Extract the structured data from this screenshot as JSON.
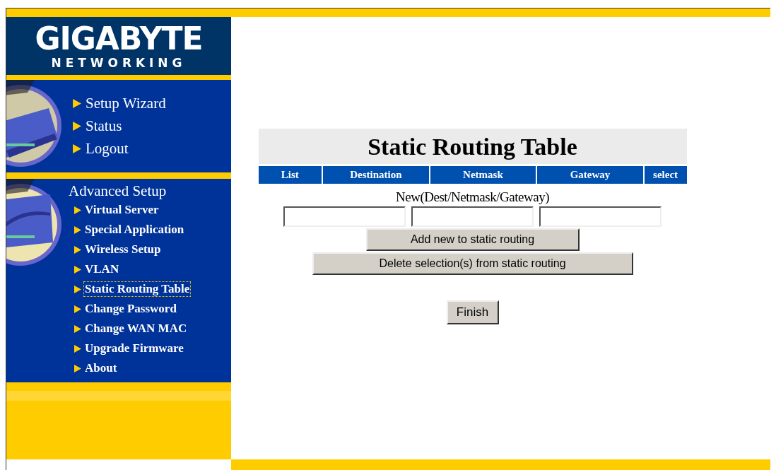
{
  "logo": {
    "brand": "GIGABYTE",
    "subtitle": "NETWORKING"
  },
  "top_menu": [
    {
      "label": "Setup Wizard"
    },
    {
      "label": "Status"
    },
    {
      "label": "Logout"
    }
  ],
  "advanced_setup": {
    "heading": "Advanced Setup",
    "items": [
      {
        "label": "Virtual Server",
        "selected": false
      },
      {
        "label": "Special Application",
        "selected": false
      },
      {
        "label": "Wireless Setup",
        "selected": false
      },
      {
        "label": "VLAN",
        "selected": false
      },
      {
        "label": "Static Routing Table",
        "selected": true
      },
      {
        "label": "Change Password",
        "selected": false
      },
      {
        "label": "Change WAN MAC",
        "selected": false
      },
      {
        "label": "Upgrade Firmware",
        "selected": false
      },
      {
        "label": "About",
        "selected": false
      }
    ]
  },
  "page": {
    "title": "Static Routing Table",
    "columns": [
      "List",
      "Destination",
      "Netmask",
      "Gateway",
      "select"
    ],
    "new_label": "New(Dest/Netmask/Gateway)",
    "add_button": "Add new to static routing",
    "delete_button": "Delete selection(s) from static routing",
    "finish_button": "Finish"
  }
}
